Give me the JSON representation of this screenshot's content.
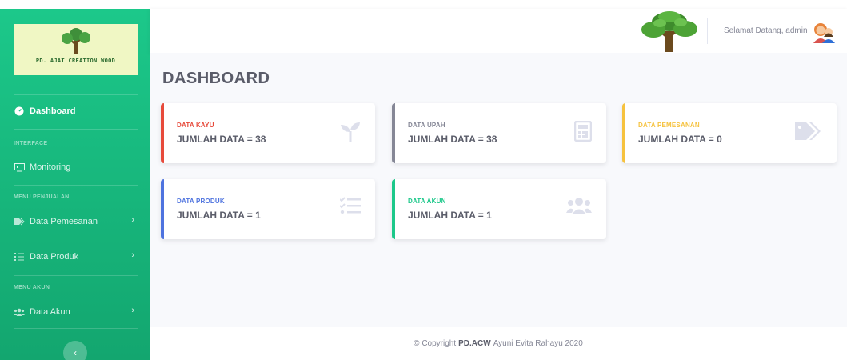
{
  "sidebar": {
    "brand_text": "PD. AJAT CREATION WOOD",
    "items": [
      {
        "label": "Dashboard"
      },
      {
        "label": "Monitoring"
      },
      {
        "label": "Data Pemesanan"
      },
      {
        "label": "Data Produk"
      },
      {
        "label": "Data Akun"
      }
    ],
    "headings": {
      "interface": "INTERFACE",
      "menu_penjualan": "MENU PENJUALAN",
      "menu_akun": "MENU AKUN"
    },
    "toggle_icon": "chevron-left-icon"
  },
  "topbar": {
    "welcome": "Selamat Datang, admin"
  },
  "main": {
    "title": "DASHBOARD",
    "cards": [
      {
        "label": "DATA KAYU",
        "value": "JUMLAH DATA = 38",
        "color": "#e74a3b",
        "icon": "seedling-icon"
      },
      {
        "label": "DATA UPAH",
        "value": "JUMLAH DATA = 38",
        "color": "#858796",
        "icon": "calculator-icon"
      },
      {
        "label": "DATA PEMESANAN",
        "value": "JUMLAH DATA = 0",
        "color": "#f6c23e",
        "icon": "tags-icon"
      },
      {
        "label": "DATA PRODUK",
        "value": "JUMLAH DATA = 1",
        "color": "#4e73df",
        "icon": "tasks-icon"
      },
      {
        "label": "DATA AKUN",
        "value": "JUMLAH DATA = 1",
        "color": "#1cc88a",
        "icon": "users-icon"
      }
    ]
  },
  "footer": {
    "prefix": "© Copyright",
    "brand": "PD.ACW",
    "suffix": "Ayuni Evita Rahayu 2020"
  }
}
